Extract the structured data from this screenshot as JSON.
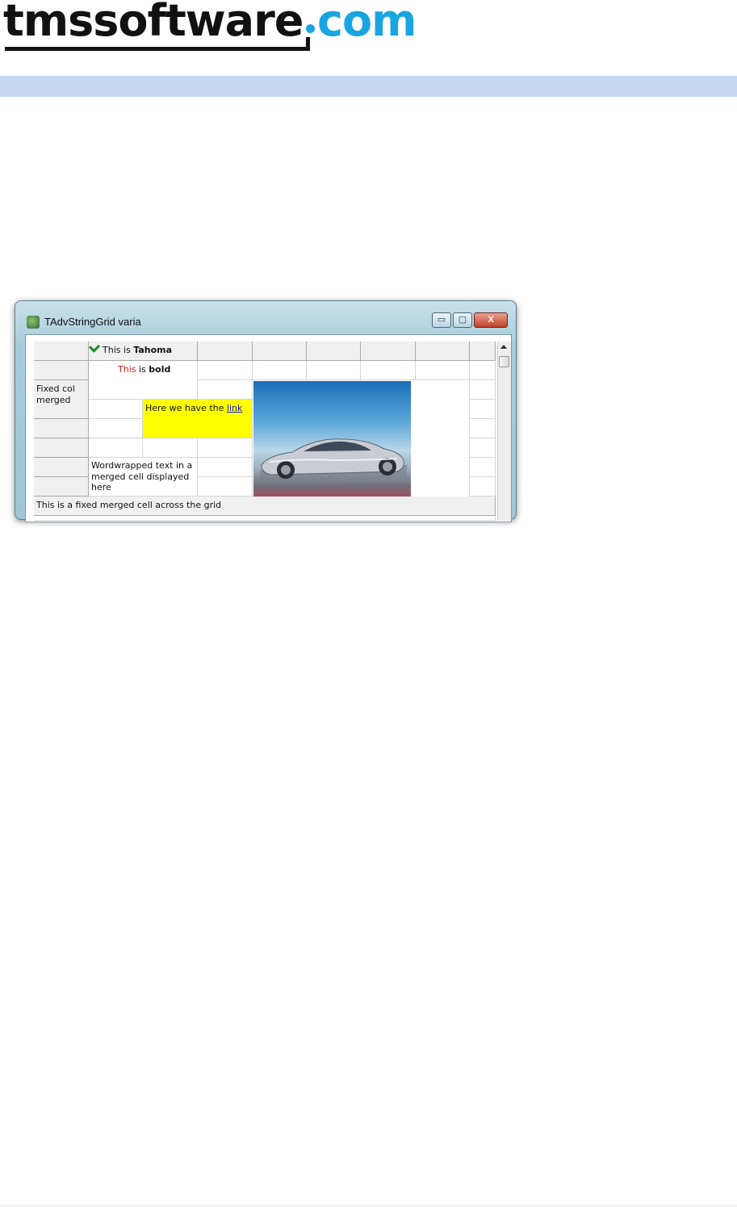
{
  "logo": {
    "part1": "tmssoftware",
    "part2": "com"
  },
  "window": {
    "title": "TAdvStringGrid varia",
    "buttons": {
      "minimize": "▭",
      "maximize": "▢",
      "close": "X"
    }
  },
  "grid": {
    "header_this_is": "This is",
    "header_tahoma": "Tahoma",
    "bold_this": "This",
    "bold_is": "is",
    "bold_word": "bold",
    "fixed_col_merged": "Fixed col\nmerged",
    "link_text": "Here we have the",
    "link_word": "link",
    "wordwrapped": "Wordwrapped text in a\nmerged cell displayed\nhere",
    "fixed_merged_row": "This is a fixed merged cell across the grid"
  },
  "colors": {
    "brand_blue": "#19a5df",
    "band": "#c6d9f0",
    "link_cell_bg": "#ffff00",
    "red_text": "#d21c1c",
    "link": "#1c1ccc"
  }
}
